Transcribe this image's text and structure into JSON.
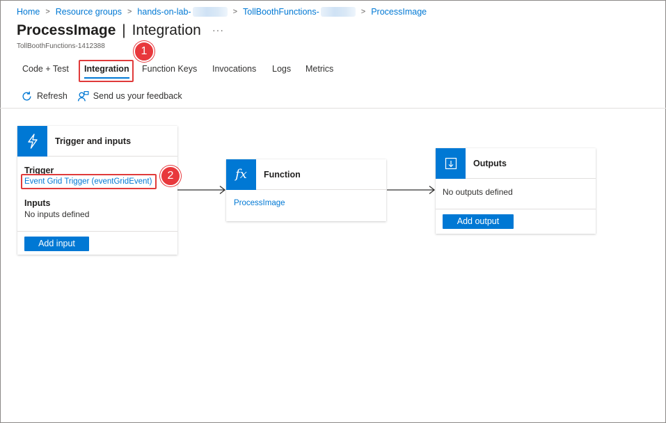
{
  "breadcrumb": {
    "items": [
      "Home",
      "Resource groups",
      "hands-on-lab-",
      "TollBoothFunctions-",
      "ProcessImage"
    ],
    "separator": ">"
  },
  "header": {
    "title_main": "ProcessImage",
    "title_divider": "|",
    "title_section": "Integration",
    "more": "···",
    "subtitle": "TollBoothFunctions-1412388"
  },
  "tabs": [
    {
      "label": "Code + Test",
      "active": false
    },
    {
      "label": "Integration",
      "active": true
    },
    {
      "label": "Function Keys",
      "active": false
    },
    {
      "label": "Invocations",
      "active": false
    },
    {
      "label": "Logs",
      "active": false
    },
    {
      "label": "Metrics",
      "active": false
    }
  ],
  "toolbar": {
    "refresh": "Refresh",
    "feedback": "Send us your feedback"
  },
  "annotations": {
    "step1": "1",
    "step2": "2",
    "color": "#e8383c"
  },
  "trigger_card": {
    "icon": "lightning-icon",
    "title": "Trigger and inputs",
    "trigger_label": "Trigger",
    "trigger_link": "Event Grid Trigger (eventGridEvent)",
    "inputs_label": "Inputs",
    "inputs_value": "No inputs defined",
    "add_button": "Add input"
  },
  "function_card": {
    "icon": "fx-icon",
    "icon_text": "fx",
    "title": "Function",
    "link": "ProcessImage"
  },
  "outputs_card": {
    "icon": "download-icon",
    "title": "Outputs",
    "value": "No outputs defined",
    "add_button": "Add output"
  },
  "colors": {
    "accent": "#0078d4",
    "highlight": "#e03a3a"
  }
}
